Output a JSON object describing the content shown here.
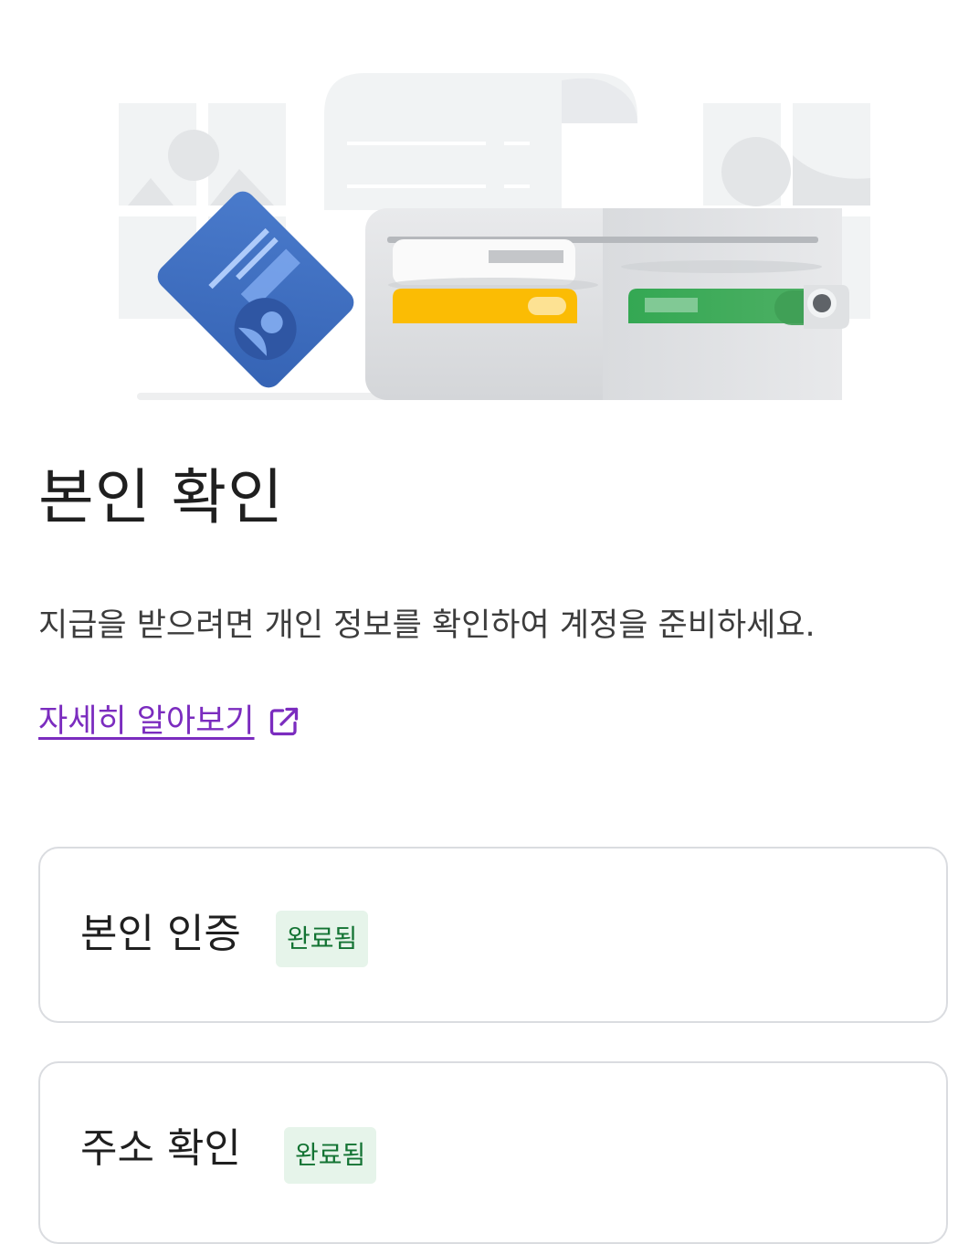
{
  "page": {
    "title": "본인 확인",
    "description": "지급을 받으려면 개인 정보를 확인하여 계정을 준비하세요.",
    "learn_more": {
      "label": "자세히 알아보기",
      "icon": "open-in-new-icon"
    }
  },
  "hero": {
    "icon": "wallet-id-card-illustration"
  },
  "verification_items": [
    {
      "label": "본인 인증",
      "status": "완료됨"
    },
    {
      "label": "주소 확인",
      "status": "완료됨"
    }
  ],
  "colors": {
    "link": "#7b2cbf",
    "badge_bg": "#e6f4ea",
    "badge_text": "#137333",
    "card_border": "#dadce0",
    "id_card_blue": "#3f6fbf",
    "wallet_yellow": "#fbbc04",
    "wallet_green": "#34a853"
  }
}
